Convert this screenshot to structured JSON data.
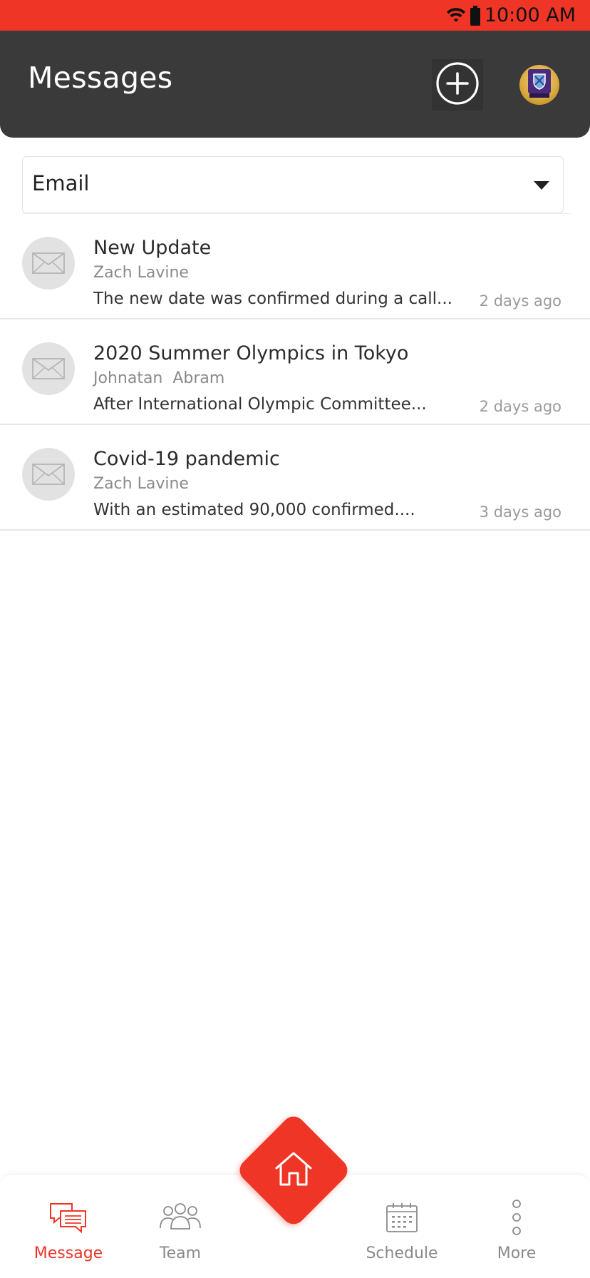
{
  "status_bar": {
    "time": "10:00 AM",
    "icons": [
      "wifi-icon",
      "battery-icon"
    ],
    "background": "#ee3526"
  },
  "header": {
    "title": "Messages",
    "add_icon": "plus-circle-icon",
    "background": "#3a3a3a"
  },
  "filter": {
    "selected": "Email",
    "icon": "chevron-down-icon"
  },
  "messages": [
    {
      "subject": "New Update",
      "sender": "Zach Lavine",
      "preview": "The new date was confirmed during a call...",
      "time": "2 days ago",
      "icon": "envelope-icon"
    },
    {
      "subject": "2020 Summer Olympics in Tokyo",
      "sender": "Johnatan  Abram",
      "preview": "After International Olympic Committee...",
      "time": "2 days ago",
      "icon": "envelope-icon"
    },
    {
      "subject": "Covid-19 pandemic",
      "sender": "Zach Lavine",
      "preview": "With an estimated 90,000 confirmed....",
      "time": "3 days ago",
      "icon": "envelope-icon"
    }
  ],
  "bottom_nav": {
    "items": [
      {
        "label": "Message",
        "icon": "chat-bubbles-icon",
        "active": true
      },
      {
        "label": "Team",
        "icon": "team-icon",
        "active": false
      },
      {
        "label": "Schedule",
        "icon": "calendar-icon",
        "active": false
      },
      {
        "label": "More",
        "icon": "more-vertical-icon",
        "active": false
      }
    ],
    "home_icon": "home-icon",
    "accent": "#ee3526"
  }
}
